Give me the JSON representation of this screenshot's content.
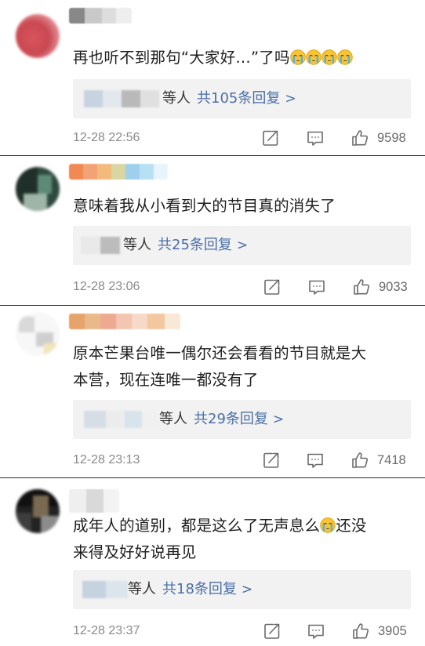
{
  "comments": [
    {
      "text_before": "再也听不到那句“大家好…”了吗",
      "emoji_count": 4,
      "reply_label": "等人",
      "reply_count": "共105条回复",
      "chevron": ">",
      "time": "12-28 22:56",
      "likes": "9598"
    },
    {
      "text_line1": "意味着我从小看到大的节目真的消失了",
      "reply_label": "等人",
      "reply_count": "共25条回复",
      "chevron": ">",
      "time": "12-28 23:06",
      "likes": "9033"
    },
    {
      "text_line1": "原本芒果台唯一偶尔还会看看的节目就是大",
      "text_line2": "本营，现在连唯一都没有了",
      "reply_label": "等人",
      "reply_count": "共29条回复",
      "chevron": ">",
      "time": "12-28 23:13",
      "likes": "7418"
    },
    {
      "text_line1_before": "成年人的道别，都是这么了无声息么",
      "text_line1_after": "还没",
      "text_line2": "来得及好好说再见",
      "reply_label": "等人",
      "reply_count": "共18条回复",
      "chevron": ">",
      "time": "12-28 23:37",
      "likes": "3905"
    }
  ],
  "icons": {
    "share": "share-icon",
    "comment": "comment-icon",
    "like": "like-icon",
    "emoji": "crying-emoji-icon"
  },
  "colors": {
    "reply_link": "#4a6fa8",
    "time_text": "#8a8a8a",
    "reply_bg": "#f2f2f2"
  }
}
